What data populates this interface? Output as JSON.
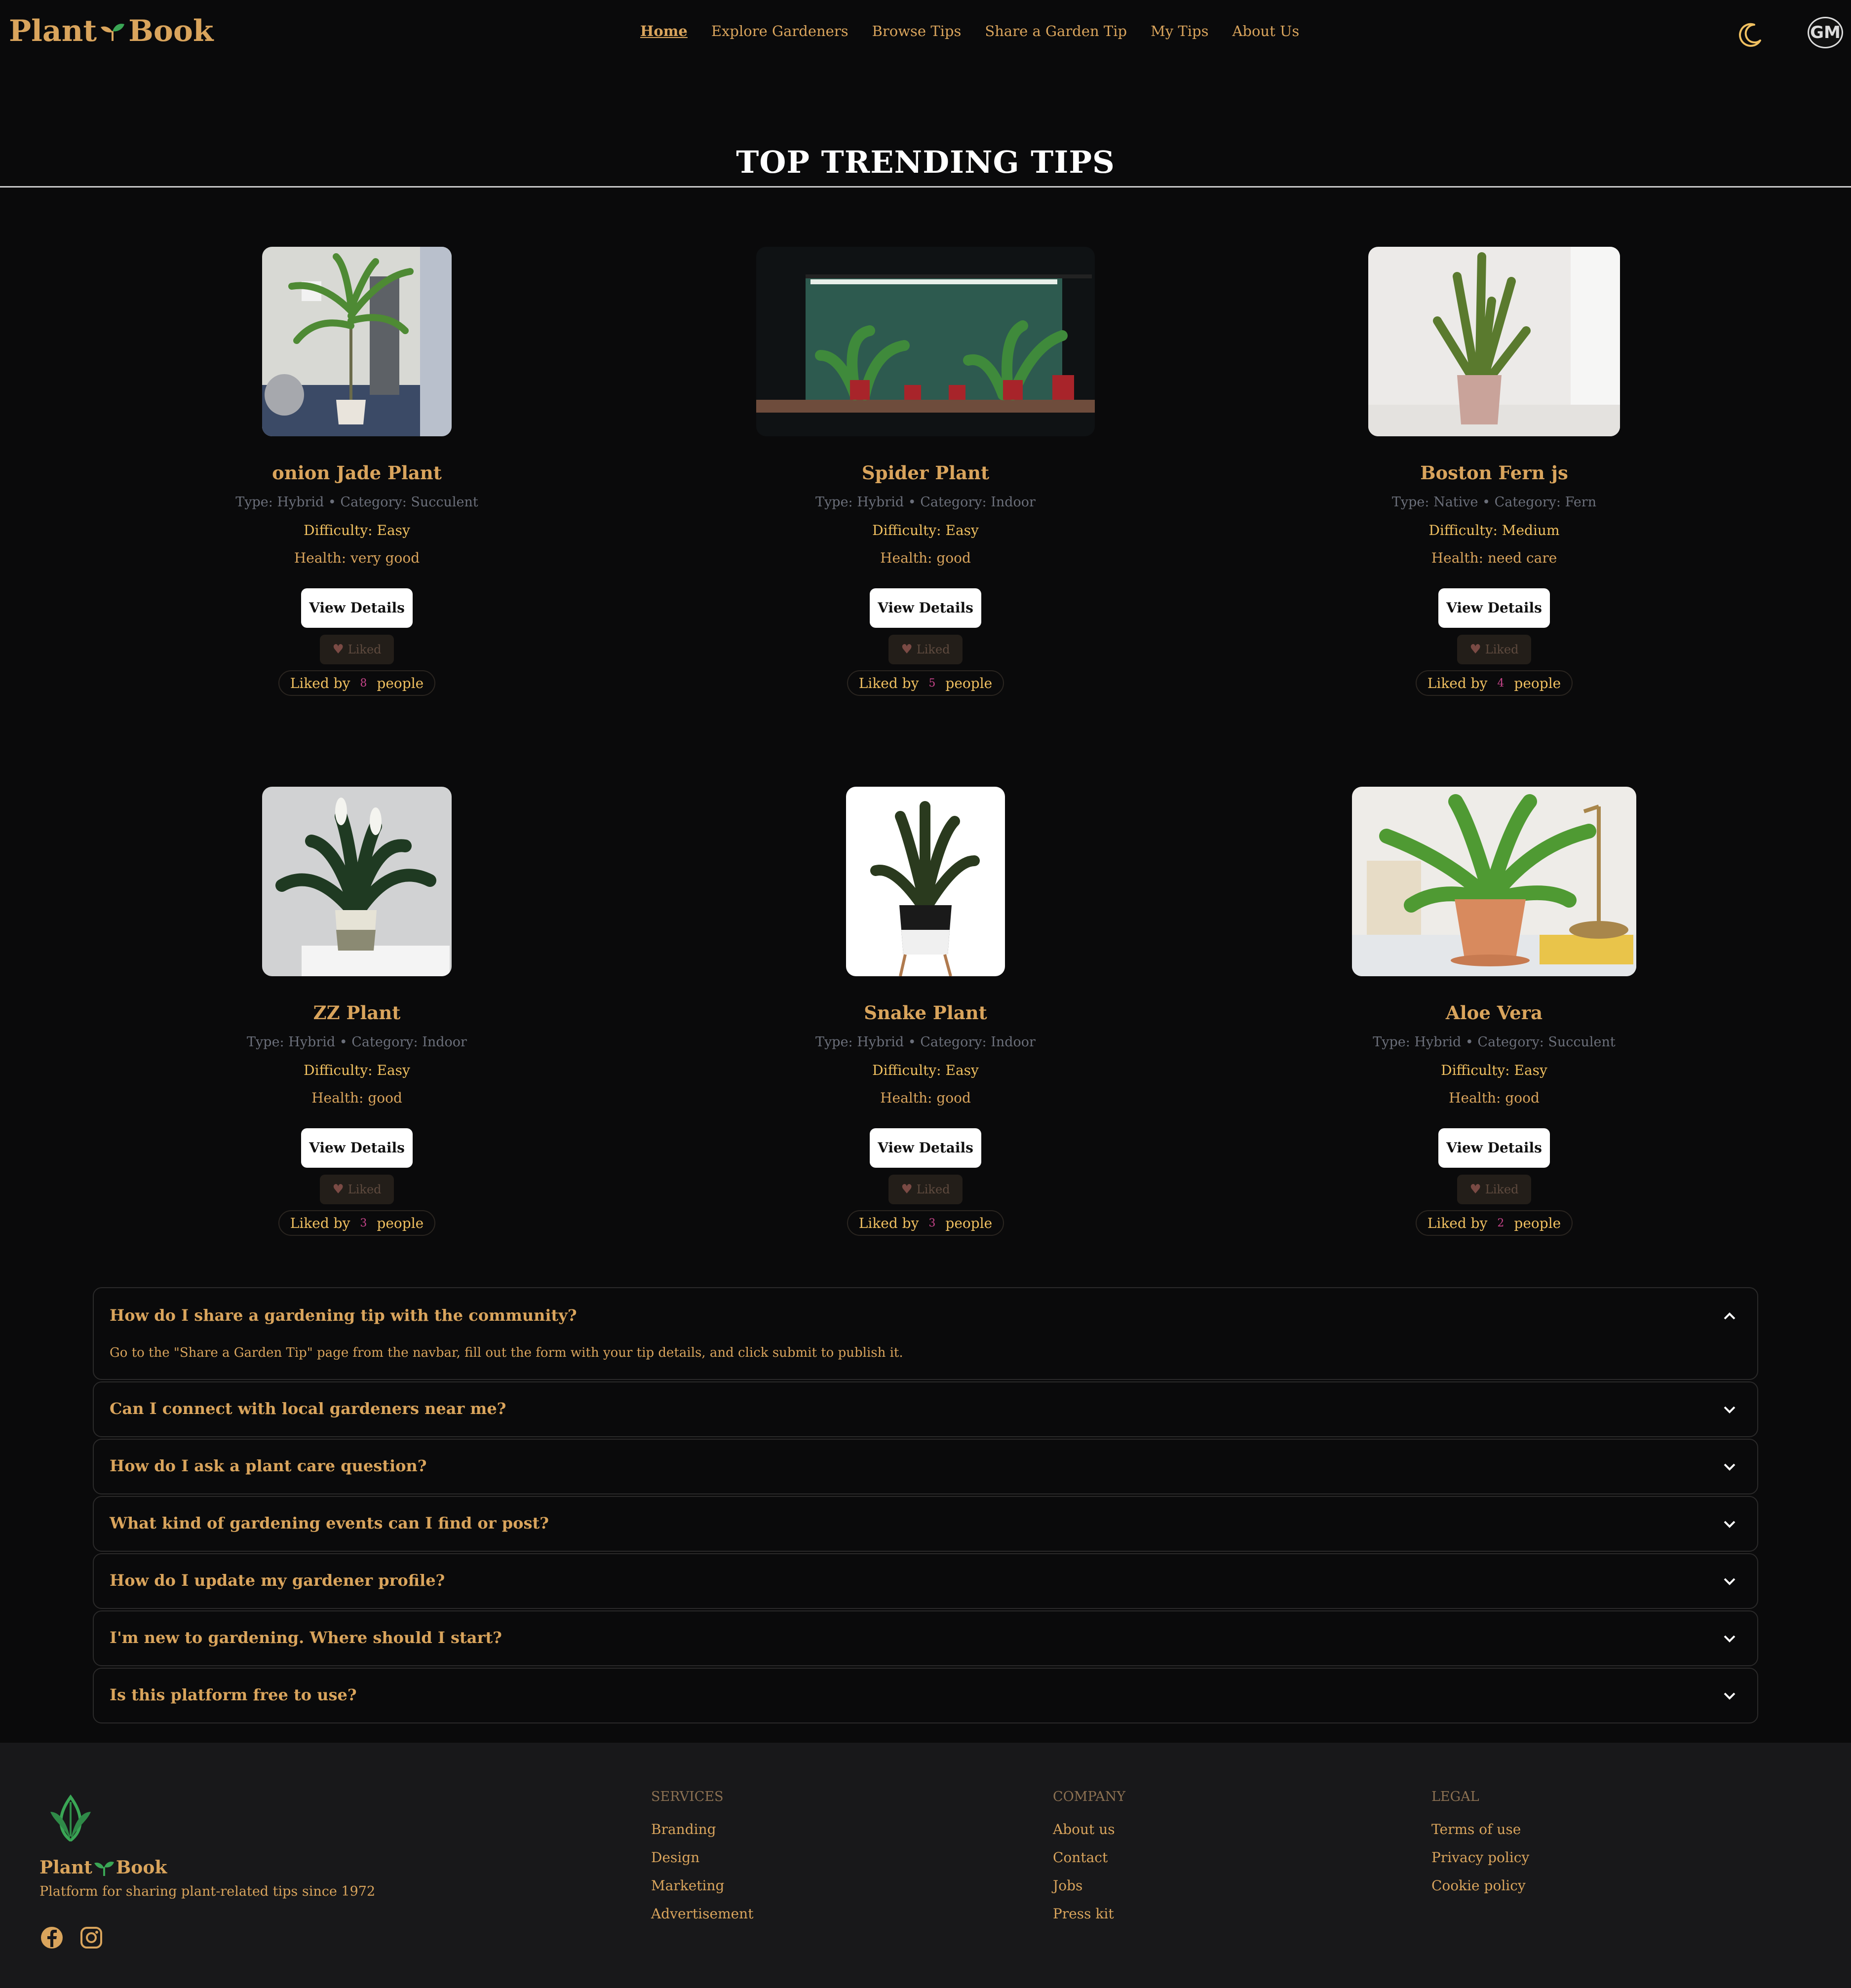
{
  "nav": {
    "logo_left": "Plant",
    "logo_right": "Book",
    "links": [
      "Home",
      "Explore Gardeners",
      "Browse Tips",
      "Share a Garden Tip",
      "My Tips",
      "About Us"
    ],
    "active_link": "Home",
    "avatar_text": "GM"
  },
  "section": {
    "title": "TOP TRENDING TIPS"
  },
  "cards": [
    {
      "name": "onion Jade Plant",
      "meta": "Type: Hybrid • Category: Succulent",
      "difficulty": "Difficulty: Easy",
      "health": "Health: very good",
      "details_label": "View Details",
      "liked_label": "Liked",
      "liked_prefix": "Liked by",
      "likes": "8",
      "liked_suffix": "people",
      "image": "palm-plant-in-corner"
    },
    {
      "name": "Spider Plant",
      "meta": "Type: Hybrid • Category: Indoor",
      "difficulty": "Difficulty: Easy",
      "health": "Health: good",
      "details_label": "View Details",
      "liked_label": "Liked",
      "liked_prefix": "Liked by",
      "likes": "5",
      "liked_suffix": "people",
      "image": "plants-under-grow-light"
    },
    {
      "name": "Boston Fern js",
      "meta": "Type: Native • Category: Fern",
      "difficulty": "Difficulty: Medium",
      "health": "Health: need care",
      "details_label": "View Details",
      "liked_label": "Liked",
      "liked_prefix": "Liked by",
      "likes": "4",
      "liked_suffix": "people",
      "image": "snake-plant-pink-pot"
    },
    {
      "name": "ZZ Plant",
      "meta": "Type: Hybrid • Category: Indoor",
      "difficulty": "Difficulty: Easy",
      "health": "Health: good",
      "details_label": "View Details",
      "liked_label": "Liked",
      "liked_prefix": "Liked by",
      "likes": "3",
      "liked_suffix": "people",
      "image": "peace-lily"
    },
    {
      "name": "Snake Plant",
      "meta": "Type: Hybrid • Category: Indoor",
      "difficulty": "Difficulty: Easy",
      "health": "Health: good",
      "details_label": "View Details",
      "liked_label": "Liked",
      "liked_prefix": "Liked by",
      "likes": "3",
      "liked_suffix": "people",
      "image": "zz-plant-black-pot"
    },
    {
      "name": "Aloe Vera",
      "meta": "Type: Hybrid • Category: Succulent",
      "difficulty": "Difficulty: Easy",
      "health": "Health: good",
      "details_label": "View Details",
      "liked_label": "Liked",
      "liked_prefix": "Liked by",
      "likes": "2",
      "liked_suffix": "people",
      "image": "birds-nest-fern-terracotta"
    }
  ],
  "faq": [
    {
      "q": "How do I share a gardening tip with the community?",
      "a": "Go to the \"Share a Garden Tip\" page from the navbar, fill out the form with your tip details, and click submit to publish it.",
      "open": true
    },
    {
      "q": "Can I connect with local gardeners near me?",
      "open": false
    },
    {
      "q": "How do I ask a plant care question?",
      "open": false
    },
    {
      "q": "What kind of gardening events can I find or post?",
      "open": false
    },
    {
      "q": "How do I update my gardener profile?",
      "open": false
    },
    {
      "q": "I'm new to gardening. Where should I start?",
      "open": false
    },
    {
      "q": "Is this platform free to use?",
      "open": false
    }
  ],
  "footer": {
    "brand_left": "Plant",
    "brand_right": "Book",
    "tagline": "Platform for sharing plant-related tips since 1972",
    "social_icons": [
      "facebook-icon",
      "instagram-icon"
    ],
    "columns": [
      {
        "title": "SERVICES",
        "links": [
          "Branding",
          "Design",
          "Marketing",
          "Advertisement"
        ]
      },
      {
        "title": "COMPANY",
        "links": [
          "About us",
          "Contact",
          "Jobs",
          "Press kit"
        ]
      },
      {
        "title": "LEGAL",
        "links": [
          "Terms of use",
          "Privacy policy",
          "Cookie policy"
        ]
      }
    ]
  },
  "colors": {
    "background": "#0a0a0b",
    "accent": "#d9a45c",
    "footer_bg": "#18181a",
    "like_count": "#c7448a"
  }
}
